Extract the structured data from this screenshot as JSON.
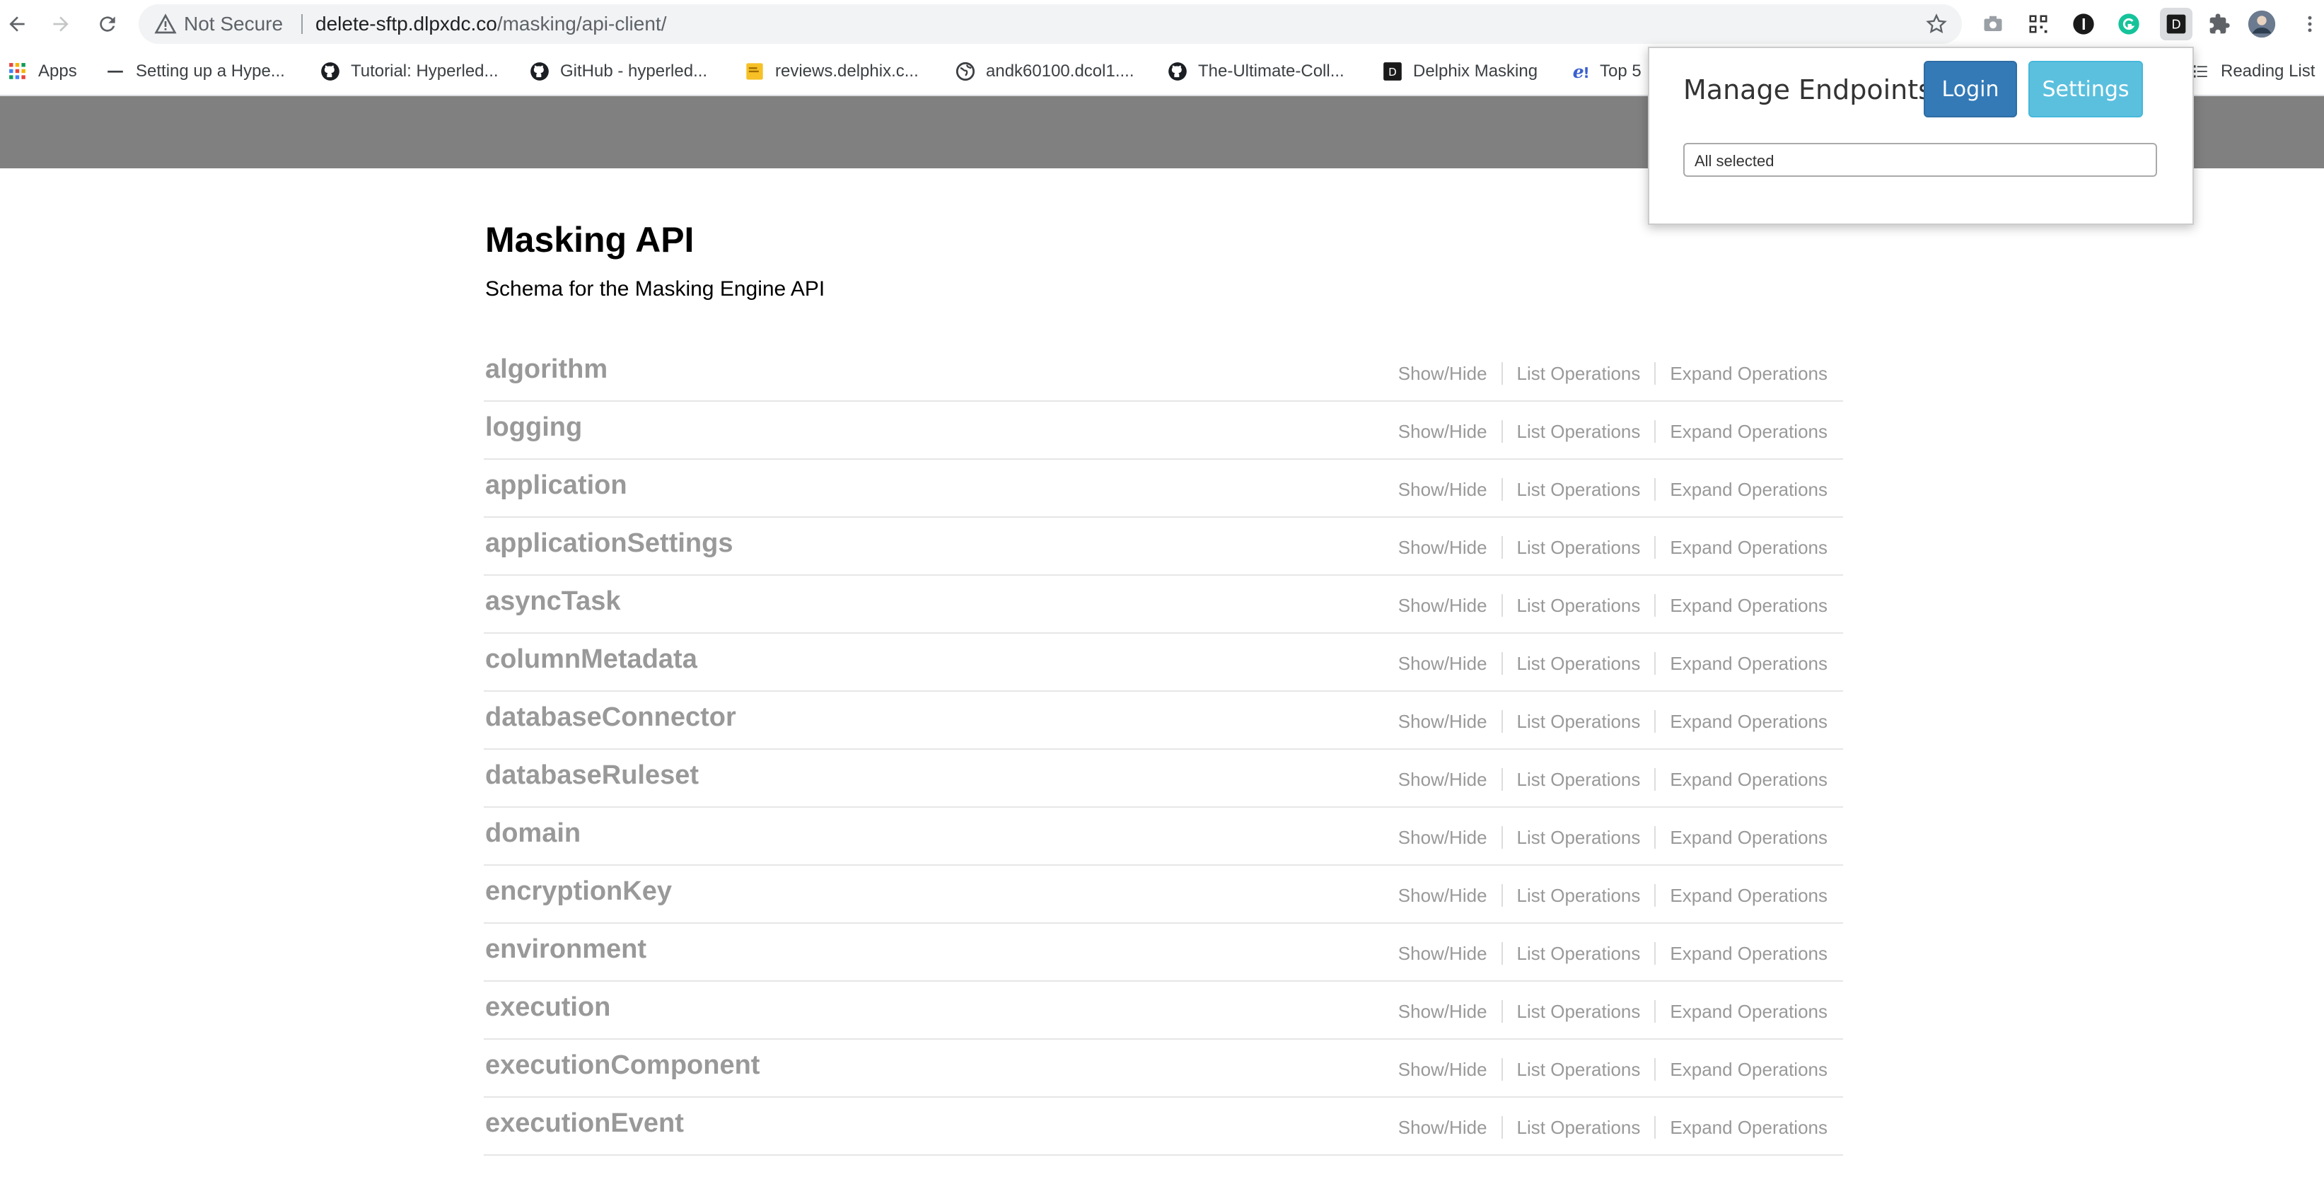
{
  "browser": {
    "security_label": "Not Secure",
    "url_host": "delete-sftp.dlpxdc.co",
    "url_path": "/masking/api-client/",
    "extensions": [
      "camera-icon",
      "qr-code-icon",
      "onepassword-icon",
      "grammarly-icon",
      "delphix-extension-icon",
      "puzzle-icon",
      "profile-avatar",
      "more-icon"
    ]
  },
  "bookmarks": [
    {
      "label": "Apps",
      "icon": "apps-grid-icon"
    },
    {
      "label": "Setting up a Hype...",
      "icon": "dash-icon"
    },
    {
      "label": "Tutorial: Hyperled...",
      "icon": "github-icon"
    },
    {
      "label": "GitHub - hyperled...",
      "icon": "github-icon"
    },
    {
      "label": "reviews.delphix.c...",
      "icon": "note-icon"
    },
    {
      "label": "andk60100.dcol1....",
      "icon": "globe-icon"
    },
    {
      "label": "The-Ultimate-Coll...",
      "icon": "github-icon"
    },
    {
      "label": "Delphix Masking",
      "icon": "delphix-icon"
    },
    {
      "label": "Top 5",
      "icon": "e-icon"
    },
    {
      "label": "Reading List",
      "icon": "reading-list-icon"
    }
  ],
  "api": {
    "title": "Masking API",
    "subtitle": "Schema for the Masking Engine API"
  },
  "resource_ops": {
    "show_hide": "Show/Hide",
    "list": "List Operations",
    "expand": "Expand Operations"
  },
  "resources": [
    {
      "name": "algorithm"
    },
    {
      "name": "logging"
    },
    {
      "name": "application"
    },
    {
      "name": "applicationSettings"
    },
    {
      "name": "asyncTask"
    },
    {
      "name": "columnMetadata"
    },
    {
      "name": "databaseConnector"
    },
    {
      "name": "databaseRuleset"
    },
    {
      "name": "domain"
    },
    {
      "name": "encryptionKey"
    },
    {
      "name": "environment"
    },
    {
      "name": "execution"
    },
    {
      "name": "executionComponent"
    },
    {
      "name": "executionEvent"
    }
  ],
  "popup": {
    "title": "Manage Endpoints",
    "login_label": "Login",
    "settings_label": "Settings",
    "select_value": "All selected"
  },
  "colors": {
    "header_band": "#808080",
    "login_button": "#337ab7",
    "settings_button": "#5bc0de",
    "resource_text": "#999999"
  }
}
